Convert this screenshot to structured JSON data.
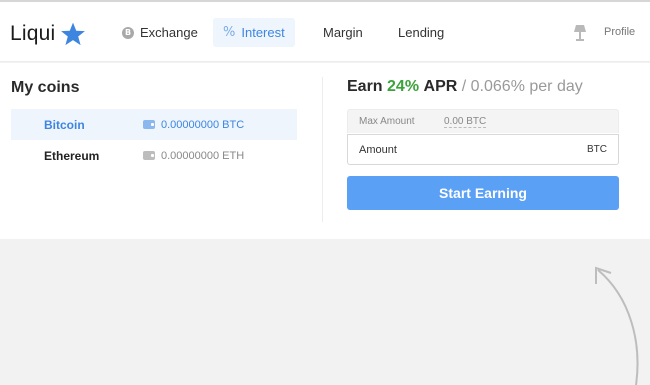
{
  "brand": {
    "name": "Liqui",
    "star_color": "#3d86e0"
  },
  "nav": {
    "exchange": {
      "label": "Exchange",
      "icon": "bitcoin-badge-icon"
    },
    "interest": {
      "label": "Interest",
      "icon": "percent-icon",
      "active": true
    },
    "margin": {
      "label": "Margin"
    },
    "lending": {
      "label": "Lending"
    }
  },
  "header_right": {
    "lamp_icon": "lamp-icon",
    "profile_label": "Profile"
  },
  "coins": {
    "title": "My coins",
    "items": [
      {
        "name": "Bitcoin",
        "balance": "0.00000000 BTC",
        "selected": true
      },
      {
        "name": "Ethereum",
        "balance": "0.00000000 ETH",
        "selected": false
      }
    ]
  },
  "earn": {
    "prefix": "Earn",
    "apr_value": "24%",
    "apr_label": "APR",
    "separator": "/",
    "per_day": "0.066% per day",
    "max_amount_label": "Max Amount",
    "max_amount_value": "0.00 BTC",
    "amount_placeholder": "Amount",
    "amount_unit": "BTC",
    "button_label": "Start Earning"
  },
  "colors": {
    "accent": "#3d86e0",
    "button": "#5aa0f4",
    "apr_green": "#3aa33a"
  }
}
